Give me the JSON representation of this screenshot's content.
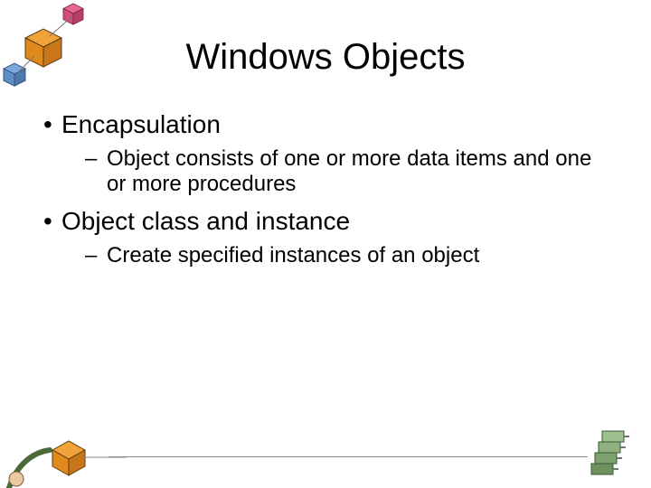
{
  "title": "Windows Objects",
  "bullets": [
    {
      "level": 1,
      "text": "Encapsulation",
      "sub": [
        {
          "text": "Object consists of one or more data items and one or more procedures"
        }
      ]
    },
    {
      "level": 1,
      "text": "Object class and instance",
      "sub": [
        {
          "text": "Create specified instances of an object"
        }
      ]
    }
  ]
}
